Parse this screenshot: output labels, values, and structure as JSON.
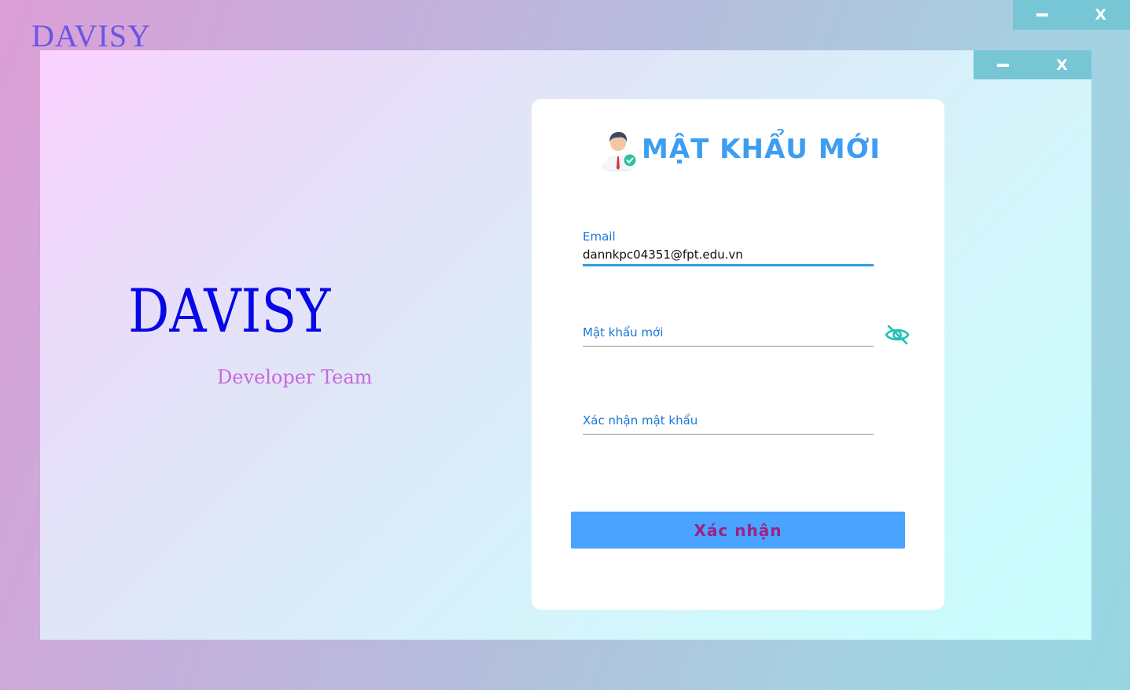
{
  "app": {
    "logo_text": "DAVISY",
    "window_controls": {
      "minimize_label": "",
      "close_label": "X"
    }
  },
  "dialog": {
    "window_controls": {
      "minimize_label": "",
      "close_label": "X"
    },
    "branding": {
      "title": "DAVISY",
      "subtitle": "Developer Team"
    },
    "card": {
      "title": "MẬT KHẨU MỚI",
      "icon": "user-verified-icon",
      "fields": {
        "email": {
          "label": "Email",
          "value": "dannkpc04351@fpt.edu.vn"
        },
        "new_password": {
          "label": "Mật khẩu mới",
          "value": ""
        },
        "confirm_password": {
          "label": "Xác nhận mật khẩu",
          "value": ""
        }
      },
      "password_visibility_icon": "eye-slash-icon",
      "submit_label": "Xác nhận"
    }
  },
  "colors": {
    "accent": "#4aa3ff",
    "window_control_bg": "#77c6d6",
    "title_blue": "#3d9df2",
    "label_blue": "#1e7ad6",
    "brand_blue": "#0606e6",
    "subtitle_purple": "#c66ad6",
    "button_text": "#9c2283"
  }
}
